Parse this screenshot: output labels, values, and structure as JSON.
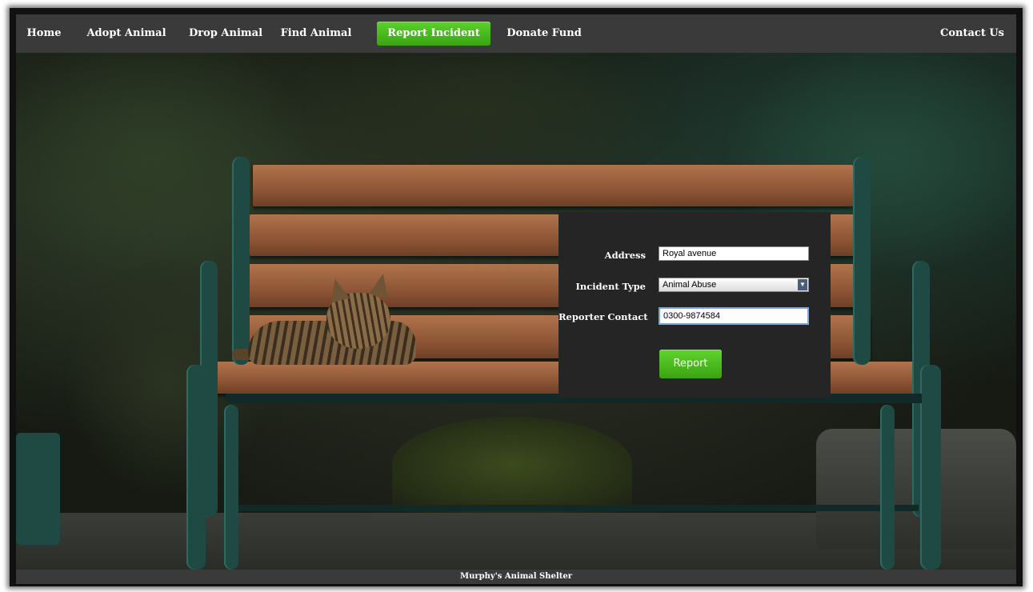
{
  "nav": {
    "items": [
      {
        "label": "Home"
      },
      {
        "label": "Adopt Animal"
      },
      {
        "label": "Drop Animal"
      },
      {
        "label": "Find Animal"
      },
      {
        "label": "Report Incident",
        "active": true
      },
      {
        "label": "Donate Fund"
      }
    ],
    "contact": "Contact Us",
    "active_color": "#4cbf1f"
  },
  "form": {
    "address_label": "Address",
    "address_value": "Royal avenue",
    "incident_type_label": "Incident Type",
    "incident_type_value": "Animal Abuse",
    "reporter_contact_label": "Reporter Contact",
    "reporter_contact_value": "0300-9874584",
    "submit_label": "Report"
  },
  "footer": {
    "text": "Murphy's Animal Shelter"
  },
  "colors": {
    "navbar": "#3a3a3a",
    "panel": "#252525",
    "accent": "#4cbf1f"
  },
  "background": {
    "image": "cat-on-bench-photo"
  }
}
